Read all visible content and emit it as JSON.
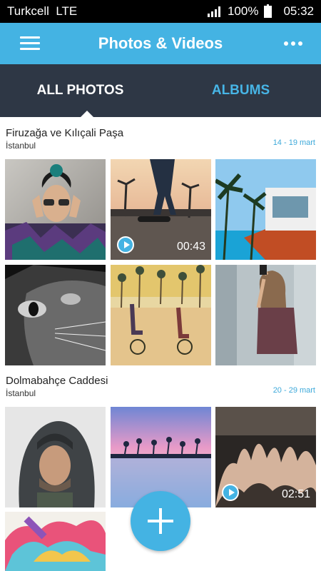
{
  "status": {
    "carrier": "Turkcell",
    "network": "LTE",
    "battery": "100%",
    "time": "05:32"
  },
  "appbar": {
    "title": "Photos & Videos",
    "menu_icon": "hamburger-menu-icon",
    "more_icon": "more-dots-icon"
  },
  "tabs": [
    {
      "label": "ALL PHOTOS",
      "active": true
    },
    {
      "label": "ALBUMS",
      "active": false
    }
  ],
  "sections": [
    {
      "title": "Firuzağa ve Kılıçali Paşa",
      "location": "İstanbul",
      "dates": "14 - 19 mart",
      "items": [
        {
          "kind": "photo",
          "subject": "woman with sunglasses and floral shirt"
        },
        {
          "kind": "video",
          "subject": "skateboarder at palm sunset",
          "duration": "00:43"
        },
        {
          "kind": "photo",
          "subject": "modern villa pool with palm trees"
        },
        {
          "kind": "photo",
          "subject": "black and white cat"
        },
        {
          "kind": "photo",
          "subject": "cyclists at vintage beach"
        },
        {
          "kind": "photo",
          "subject": "girl taking photo with phone"
        }
      ]
    },
    {
      "title": "Dolmabahçe Caddesi",
      "location": "İstanbul",
      "dates": "20 - 29 mart",
      "items": [
        {
          "kind": "photo",
          "subject": "man in grey hoodie"
        },
        {
          "kind": "photo",
          "subject": "pink sunset over sea with palms"
        },
        {
          "kind": "video",
          "subject": "concert crowd",
          "duration": "02:51"
        },
        {
          "kind": "photo",
          "subject": "colorful abstract album art"
        }
      ]
    }
  ],
  "fab": {
    "icon": "plus-icon"
  },
  "colors": {
    "accent": "#44b3e3",
    "tabbar": "#2e3745"
  }
}
